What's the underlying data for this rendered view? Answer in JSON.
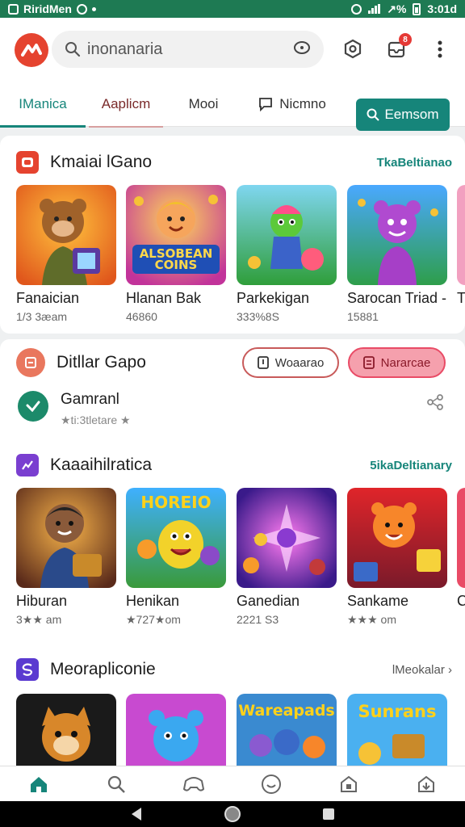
{
  "status_bar": {
    "app_label": "RiridMen",
    "right_text": "↗%",
    "time": "3:01d"
  },
  "header": {
    "search_placeholder": "inonanaria",
    "notification_badge": "8"
  },
  "tabs": [
    {
      "label": "IManica",
      "active": true
    },
    {
      "label": "Aaplicm",
      "active": false
    },
    {
      "label": "Mooi",
      "active": false
    },
    {
      "label": "Nicmno",
      "active": false
    }
  ],
  "tab_button": {
    "label": "Eemsom"
  },
  "section1": {
    "title": "Kmaiai lGano",
    "link": "TkaBeltianao",
    "games": [
      {
        "name": "Fanaician",
        "meta": "1/3 3æam",
        "art": "bear-hand"
      },
      {
        "name": "Hlanan Bak",
        "meta": "46860",
        "art": "coins"
      },
      {
        "name": "Parkekigan",
        "meta": "333%8S",
        "art": "green-hero"
      },
      {
        "name": "Sarocan Triad -",
        "meta": "15881",
        "art": "purple-bear"
      },
      {
        "name": "T",
        "meta": "",
        "art": "pink"
      }
    ],
    "overlay_text": "ALSOBEAN COINS"
  },
  "section2": {
    "title": "Ditllar Gapo",
    "btn_outline": "Woaarao",
    "btn_pink": "Nararcae",
    "list_item": {
      "name": "Gamranl",
      "meta": "★ti:3tletare ★"
    }
  },
  "section3": {
    "title": "Kaaaihilratica",
    "link": "5ikaDeltianary",
    "games": [
      {
        "name": "Hiburan",
        "meta": "3★★ am",
        "art": "boy"
      },
      {
        "name": "Henikan",
        "meta": "★727★om",
        "art": "yellow-monster"
      },
      {
        "name": "Ganedian",
        "meta": "2221 S3",
        "art": "purple-burst"
      },
      {
        "name": "Sankame",
        "meta": "★★★ om",
        "art": "orange-bear"
      },
      {
        "name": "C",
        "meta": "★",
        "art": "edge"
      }
    ],
    "overlay_text": "HOREIO"
  },
  "section4": {
    "title": "Meorapliconie",
    "link": "lMeokalar ›",
    "games": [
      {
        "art": "fox",
        "overlay": ""
      },
      {
        "art": "blue-bear",
        "overlay": ""
      },
      {
        "art": "wood-pads",
        "overlay": "Wareapads"
      },
      {
        "art": "sunrans",
        "overlay": "Sunrans"
      }
    ]
  },
  "colors": {
    "accent": "#16857a",
    "brand": "#e5432f",
    "status_bar": "#1e7a53",
    "pink": "#e94b66"
  }
}
